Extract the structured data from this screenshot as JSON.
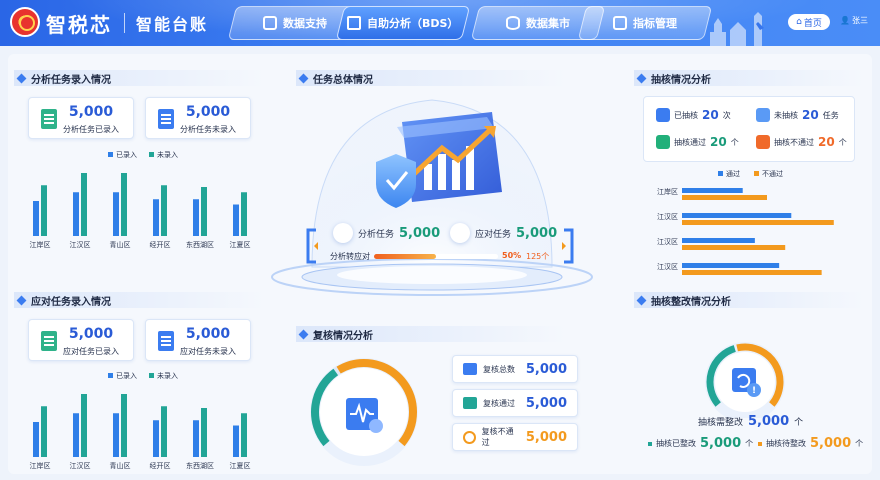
{
  "header": {
    "brand": "智税芯",
    "subtitle": "智能台账",
    "tabs": [
      {
        "label": "数据支持",
        "icon": "layers-icon",
        "active": false
      },
      {
        "label": "自助分析（BDS）",
        "icon": "cube-icon",
        "active": true
      },
      {
        "label": "数据集市",
        "icon": "database-icon",
        "active": false
      },
      {
        "label": "指标管理",
        "icon": "chart-icon",
        "active": false
      }
    ],
    "home_label": "首页",
    "user_name": "张三"
  },
  "analysis_entry": {
    "title": "分析任务录入情况",
    "cards": [
      {
        "value": "5,000",
        "label": "分析任务已录入"
      },
      {
        "value": "5,000",
        "label": "分析任务未录入"
      }
    ],
    "legend": [
      "已录入",
      "未录入"
    ]
  },
  "response_entry": {
    "title": "应对任务录入情况",
    "cards": [
      {
        "value": "5,000",
        "label": "应对任务已录入"
      },
      {
        "value": "5,000",
        "label": "应对任务未录入"
      }
    ],
    "legend": [
      "已录入",
      "未录入"
    ]
  },
  "task_overall": {
    "title": "任务总体情况",
    "analysis_label": "分析任务",
    "analysis_value": "5,000",
    "response_label": "应对任务",
    "response_value": "5,000",
    "conversion_label": "分析转应对",
    "conversion_percent": "50%",
    "conversion_count": "125个",
    "conversion_fraction": 0.5
  },
  "review": {
    "title": "复核情况分析",
    "items": [
      {
        "label": "复核总数",
        "value": "5,000"
      },
      {
        "label": "复核通过",
        "value": "5,000"
      },
      {
        "label": "复核不通过",
        "value": "5,000"
      }
    ],
    "gauge_fraction": 0.62
  },
  "sampling": {
    "title": "抽核情况分析",
    "stats": [
      {
        "label": "已抽核",
        "value": "20",
        "unit": "次"
      },
      {
        "label": "未抽核",
        "value": "20",
        "unit": "任务"
      },
      {
        "label": "抽核通过",
        "value": "20",
        "unit": "个"
      },
      {
        "label": "抽核不通过",
        "value": "20",
        "unit": "个"
      }
    ],
    "legend": [
      "通过",
      "不通过"
    ]
  },
  "rectification": {
    "title": "抽核整改情况分析",
    "need_label": "抽核需整改",
    "need_value": "5,000",
    "need_unit": "个",
    "done_label": "抽核已整改",
    "done_value": "5,000",
    "done_unit": "个",
    "pending_label": "抽核待整改",
    "pending_value": "5,000",
    "pending_unit": "个",
    "gauge_fraction": 0.55
  },
  "colors": {
    "blue": "#2f7fe8",
    "teal": "#22a596",
    "orange": "#f39a1e",
    "accent": "#2a66e6"
  },
  "chart_data": [
    {
      "type": "bar",
      "categories": [
        "江岸区",
        "江汉区",
        "青山区",
        "经开区",
        "东西湖区",
        "江夏区"
      ],
      "series": [
        {
          "name": "已录入",
          "values": [
            40,
            50,
            50,
            42,
            42,
            36
          ]
        },
        {
          "name": "未录入",
          "values": [
            58,
            72,
            72,
            58,
            56,
            50
          ]
        }
      ],
      "ylim": [
        0,
        80
      ]
    },
    {
      "type": "bar",
      "categories": [
        "江岸区",
        "江汉区",
        "青山区",
        "经开区",
        "东西湖区",
        "江夏区"
      ],
      "series": [
        {
          "name": "已录入",
          "values": [
            40,
            50,
            50,
            42,
            42,
            36
          ]
        },
        {
          "name": "未录入",
          "values": [
            58,
            72,
            72,
            58,
            56,
            50
          ]
        }
      ],
      "ylim": [
        0,
        80
      ]
    },
    {
      "type": "bar",
      "orientation": "horizontal",
      "categories": [
        "江岸区",
        "江汉区",
        "江汉区",
        "江汉区"
      ],
      "series": [
        {
          "name": "通过",
          "values": [
            50,
            90,
            60,
            80
          ]
        },
        {
          "name": "不通过",
          "values": [
            70,
            125,
            85,
            115
          ]
        }
      ],
      "xlim": [
        0,
        140
      ]
    }
  ]
}
